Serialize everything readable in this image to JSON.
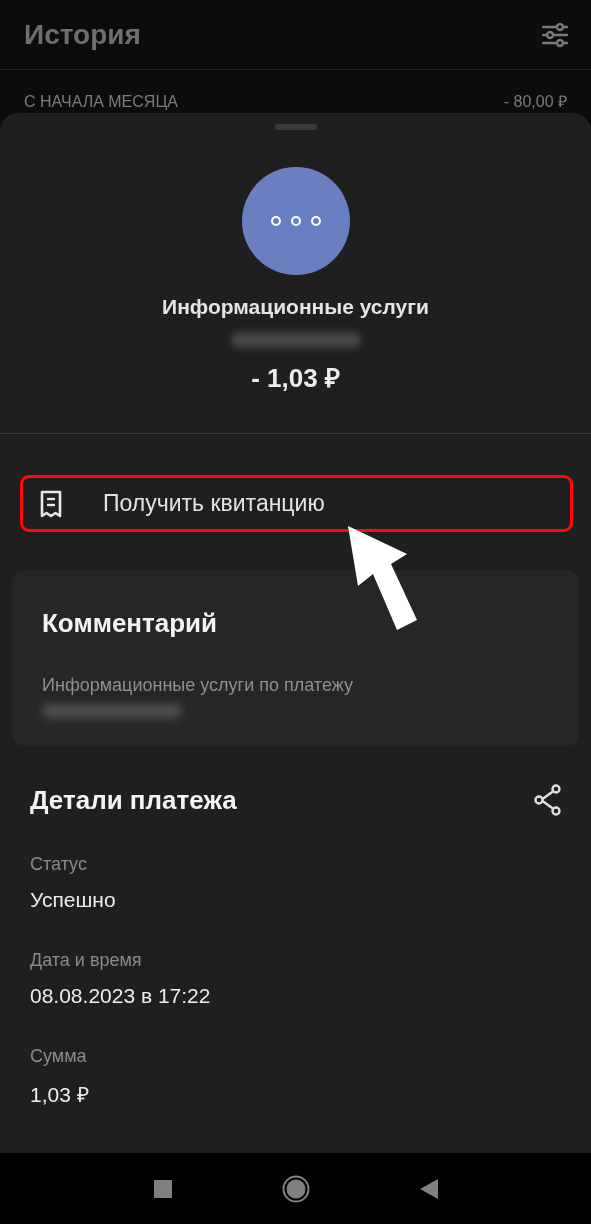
{
  "header": {
    "title": "История",
    "summary": {
      "label": "С НАЧАЛА МЕСЯЦА",
      "amount": "- 80,00 ₽"
    }
  },
  "payee": {
    "name": "Информационные услуги",
    "amount": "- 1,03 ₽"
  },
  "actions": [
    {
      "label": "Получить квитанцию",
      "highlighted": true
    }
  ],
  "comment": {
    "title": "Комментарий",
    "text": "Информационные услуги по платежу"
  },
  "details": {
    "title": "Детали платежа",
    "fields": [
      {
        "label": "Статус",
        "value": "Успешно"
      },
      {
        "label": "Дата и время",
        "value": "08.08.2023 в 17:22"
      },
      {
        "label": "Сумма",
        "value": "1,03 ₽"
      }
    ]
  }
}
